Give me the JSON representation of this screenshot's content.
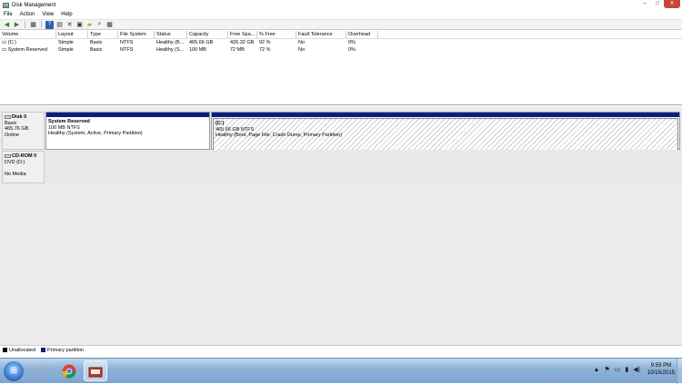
{
  "window": {
    "title": "Disk Management",
    "controls": {
      "minimize": "–",
      "maximize": "□",
      "close": "✕"
    }
  },
  "menu": [
    "File",
    "Action",
    "View",
    "Help"
  ],
  "toolbar_icons": [
    "back-icon",
    "forward-icon",
    "view-icon",
    "help-icon",
    "properties-icon",
    "delete-icon",
    "check-icon",
    "open-icon",
    "search-icon",
    "grid-icon"
  ],
  "volume_table": {
    "columns": [
      "Volume",
      "Layout",
      "Type",
      "File System",
      "Status",
      "Capacity",
      "Free Spa...",
      "% Free",
      "Fault Tolerance",
      "Overhead"
    ],
    "rows": [
      [
        "(C:)",
        "Simple",
        "Basic",
        "NTFS",
        "Healthy (B...",
        "465.66 GB",
        "426.32 GB",
        "92 %",
        "No",
        "0%"
      ],
      [
        "System Reserved",
        "Simple",
        "Basic",
        "NTFS",
        "Healthy (S...",
        "100 MB",
        "72 MB",
        "72 %",
        "No",
        "0%"
      ]
    ]
  },
  "disks": [
    {
      "name": "Disk 0",
      "type": "Basic",
      "size": "465.76 GB",
      "status": "Online",
      "partitions": [
        {
          "name": "System Reserved",
          "size": "100 MB NTFS",
          "status": "Healthy (System, Active, Primary Partition)"
        },
        {
          "name": "(C:)",
          "size": "465.66 GB NTFS",
          "status": "Healthy (Boot, Page File, Crash Dump, Primary Partition)"
        }
      ]
    },
    {
      "name": "CD-ROM 0",
      "type": "DVD (D:)",
      "status": "No Media"
    }
  ],
  "legend": [
    {
      "label": "Unallocated",
      "color": "#000000"
    },
    {
      "label": "Primary partition",
      "color": "#0a1e80"
    }
  ],
  "taskbar": {
    "time": "9:59 PM",
    "date": "10/15/2015"
  }
}
